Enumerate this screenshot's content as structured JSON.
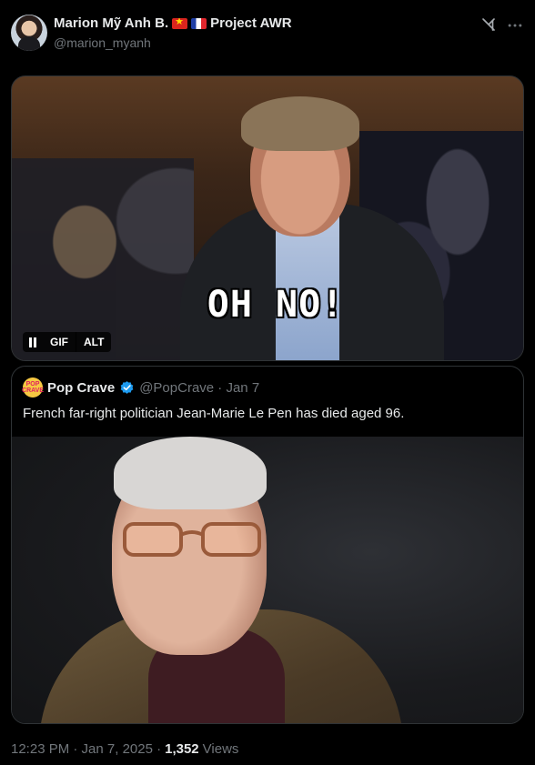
{
  "tweet": {
    "author_name": "Marion Mỹ Anh B.",
    "author_suffix": "Project AWR",
    "author_handle": "@marion_myanh",
    "media": {
      "caption": "OH NO!",
      "controls": {
        "gif_label": "GIF",
        "alt_label": "ALT"
      }
    },
    "quote": {
      "avatar_text": "POP CRAVE",
      "name": "Pop Crave",
      "handle_time": "@PopCrave · Jan 7",
      "text": "French far-right politician Jean-Marie Le Pen has died aged 96."
    },
    "meta": {
      "time_date": "12:23 PM · Jan 7, 2025 ·",
      "views_count": "1,352",
      "views_label": "Views"
    }
  },
  "colors": {
    "background": "#000000",
    "text_primary": "#e7e9ea",
    "text_secondary": "#71767b",
    "verified": "#1d9bf0",
    "border": "#2f3336"
  },
  "icons": [
    "avatar",
    "vietnam-flag-icon",
    "france-flag-icon",
    "grok-icon",
    "more-icon",
    "pause-icon",
    "verified-badge-icon"
  ]
}
